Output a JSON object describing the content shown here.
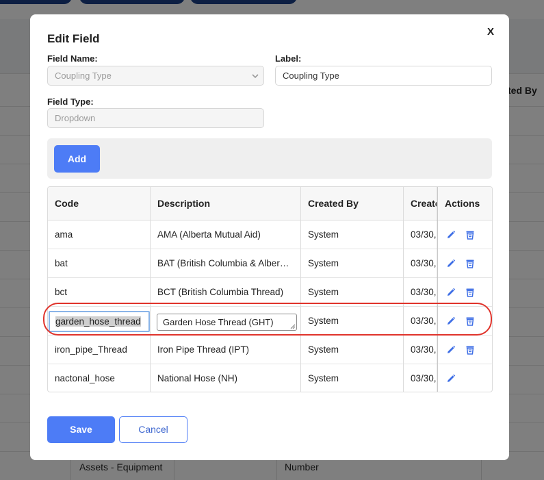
{
  "background": {
    "created_by_header": "ted By",
    "bottom_row": {
      "col1": "Assets - Equipment",
      "col2": "Number"
    }
  },
  "modal": {
    "title": "Edit Field",
    "close_label": "X",
    "field_name": {
      "label": "Field Name:",
      "value": "Coupling Type"
    },
    "label_field": {
      "label": "Label:",
      "value": "Coupling Type"
    },
    "field_type": {
      "label": "Field Type:",
      "value": "Dropdown"
    },
    "add_button": "Add",
    "table": {
      "headers": [
        "Code",
        "Description",
        "Created By",
        "Create",
        "Actions"
      ],
      "rows": [
        {
          "code": "ama",
          "description": "AMA (Alberta Mutual Aid)",
          "created_by": "System",
          "created": "03/30,"
        },
        {
          "code": "bat",
          "description": "BAT (British Columbia & Alber…",
          "created_by": "System",
          "created": "03/30,"
        },
        {
          "code": "bct",
          "description": "BCT (British Columbia Thread)",
          "created_by": "System",
          "created": "03/30,"
        },
        {
          "code": "garden_hose_thread",
          "description": "Garden Hose Thread (GHT)",
          "created_by": "System",
          "created": "03/30,"
        },
        {
          "code": "iron_pipe_Thread",
          "description": "Iron Pipe Thread (IPT)",
          "created_by": "System",
          "created": "03/30,"
        },
        {
          "code": "nactonal_hose",
          "description": "National Hose (NH)",
          "created_by": "System",
          "created": "03/30,"
        }
      ]
    },
    "save_button": "Save",
    "cancel_button": "Cancel",
    "colors": {
      "primary": "#4d7cf6",
      "highlight": "#e0332b"
    }
  }
}
